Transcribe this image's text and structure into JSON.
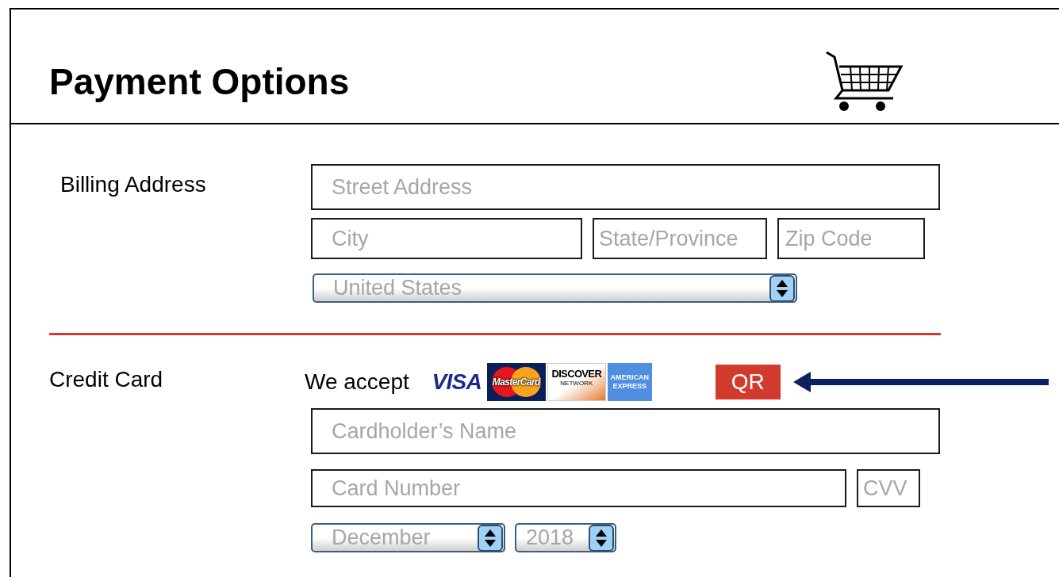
{
  "header": {
    "title": "Payment Options"
  },
  "billing": {
    "label": "Billing Address",
    "street": {
      "placeholder": "Street Address"
    },
    "city": {
      "placeholder": "City"
    },
    "state": {
      "placeholder": "State/Province"
    },
    "zip": {
      "placeholder": "Zip Code"
    },
    "country": {
      "value": "United States"
    }
  },
  "credit_card": {
    "label": "Credit Card",
    "accept_label": "We accept",
    "card_logos": [
      {
        "kind": "visa",
        "text": "VISA"
      },
      {
        "kind": "mastercard",
        "text": "MasterCard"
      },
      {
        "kind": "discover",
        "text": "DISCOVER",
        "subtext": "NETWORK"
      },
      {
        "kind": "amex",
        "text": "AMERICAN",
        "subtext": "EXPRESS"
      }
    ],
    "qr_button": "QR",
    "cardholder": {
      "placeholder": "Cardholder’s Name"
    },
    "card_number": {
      "placeholder": "Card Number"
    },
    "cvv": {
      "placeholder": "CVV"
    },
    "expiry_month": {
      "value": "December"
    },
    "expiry_year": {
      "value": "2018"
    }
  }
}
